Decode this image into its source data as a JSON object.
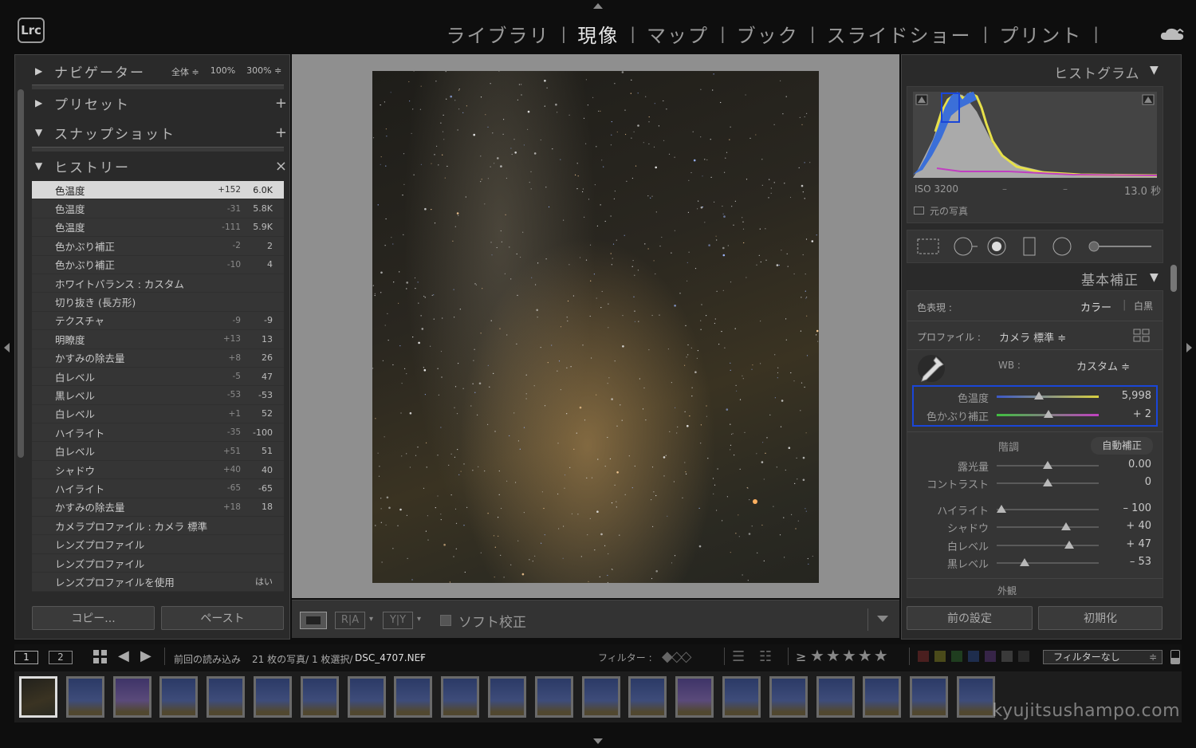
{
  "app": {
    "logo": "Lrc",
    "cloud_icon": "cloud-icon"
  },
  "modules": [
    {
      "label": "ライブラリ",
      "active": false
    },
    {
      "label": "現像",
      "active": true
    },
    {
      "label": "マップ",
      "active": false
    },
    {
      "label": "ブック",
      "active": false
    },
    {
      "label": "スライドショー",
      "active": false
    },
    {
      "label": "プリント",
      "active": false
    }
  ],
  "left_panel": {
    "navigator": {
      "title": "ナビゲーター",
      "opt_fit": "全体 ≑",
      "opt_100": "100%",
      "opt_300": "300% ≑"
    },
    "presets": {
      "title": "プリセット",
      "add": "+"
    },
    "snapshots": {
      "title": "スナップショット",
      "add": "+"
    },
    "history": {
      "title": "ヒストリー",
      "clear": "×",
      "items": [
        {
          "name": "色温度",
          "delta": "+152",
          "value": "6.0K",
          "selected": true
        },
        {
          "name": "色温度",
          "delta": "-31",
          "value": "5.8K"
        },
        {
          "name": "色温度",
          "delta": "-111",
          "value": "5.9K"
        },
        {
          "name": "色かぶり補正",
          "delta": "-2",
          "value": "2"
        },
        {
          "name": "色かぶり補正",
          "delta": "-10",
          "value": "4"
        },
        {
          "name": "ホワイトバランス : カスタム",
          "delta": "",
          "value": ""
        },
        {
          "name": "切り抜き (長方形)",
          "delta": "",
          "value": ""
        },
        {
          "name": "テクスチャ",
          "delta": "-9",
          "value": "-9"
        },
        {
          "name": "明瞭度",
          "delta": "+13",
          "value": "13"
        },
        {
          "name": "かすみの除去量",
          "delta": "+8",
          "value": "26"
        },
        {
          "name": "白レベル",
          "delta": "-5",
          "value": "47"
        },
        {
          "name": "黒レベル",
          "delta": "-53",
          "value": "-53"
        },
        {
          "name": "白レベル",
          "delta": "+1",
          "value": "52"
        },
        {
          "name": "ハイライト",
          "delta": "-35",
          "value": "-100"
        },
        {
          "name": "白レベル",
          "delta": "+51",
          "value": "51"
        },
        {
          "name": "シャドウ",
          "delta": "+40",
          "value": "40"
        },
        {
          "name": "ハイライト",
          "delta": "-65",
          "value": "-65"
        },
        {
          "name": "かすみの除去量",
          "delta": "+18",
          "value": "18"
        },
        {
          "name": "カメラプロファイル : カメラ 標準",
          "delta": "",
          "value": ""
        },
        {
          "name": "レンズプロファイル",
          "delta": "",
          "value": ""
        },
        {
          "name": "レンズプロファイル",
          "delta": "",
          "value": ""
        },
        {
          "name": "レンズプロファイルを使用",
          "delta": "",
          "value": "はい"
        }
      ]
    },
    "copy_button": "コピー...",
    "paste_button": "ペースト"
  },
  "toolbar": {
    "soft_proof": "ソフト校正",
    "ra": "R|A",
    "yy": "Y|Y"
  },
  "right_panel": {
    "histogram": {
      "title": "ヒストグラム",
      "iso": "ISO 3200",
      "dash1": "–",
      "dash2": "–",
      "shutter": "13.0 秒",
      "original_photo": "元の写真"
    },
    "basic": {
      "title": "基本補正",
      "treatment_label": "色表現 :",
      "color": "カラー",
      "bw": "白黒",
      "profile_label": "プロファイル :",
      "profile_value": "カメラ 標準 ≑",
      "wb_label": "WB :",
      "wb_value": "カスタム ≑",
      "temp_label": "色温度",
      "temp_value": "5,998",
      "tint_label": "色かぶり補正",
      "tint_value": "+ 2",
      "tone_label": "階調",
      "auto": "自動補正",
      "sliders": [
        {
          "label": "露光量",
          "value": "0.00",
          "pos": 0.5
        },
        {
          "label": "コントラスト",
          "value": "0",
          "pos": 0.5
        },
        {
          "label": "ハイライト",
          "value": "– 100",
          "pos": 0.05
        },
        {
          "label": "シャドウ",
          "value": "+ 40",
          "pos": 0.68
        },
        {
          "label": "白レベル",
          "value": "+ 47",
          "pos": 0.71
        },
        {
          "label": "黒レベル",
          "value": "– 53",
          "pos": 0.27
        }
      ],
      "presence": "外観"
    },
    "prev_button": "前の設定",
    "reset_button": "初期化"
  },
  "filmbar": {
    "view1": "1",
    "view2": "2",
    "source": "前回の読み込み",
    "count": "21 枚の写真/ 1 枚選択/",
    "filename": "DSC_4707.NEF",
    "filter_label": "フィルター :",
    "gte": "≥",
    "filter_none": "フィルターなし"
  },
  "watermark": "kyujitsushampo.com"
}
